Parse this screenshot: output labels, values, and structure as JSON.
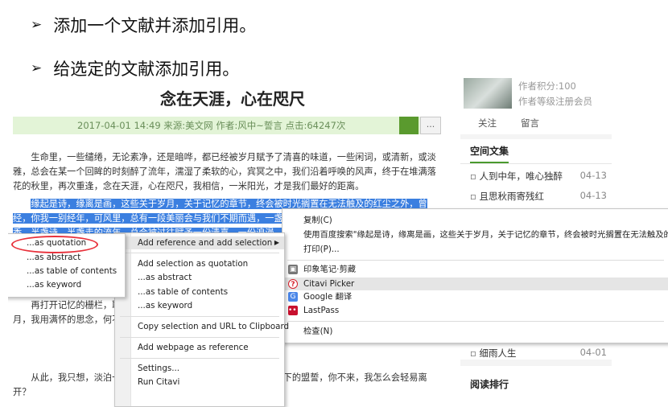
{
  "slide": {
    "bullet_marker": "➢",
    "bullet1": "添加一个文献并添加引用。",
    "bullet2": "给选定的文献添加引用。"
  },
  "article": {
    "title": "念在天涯，心在咫尺",
    "meta": "2017-04-01 14:49  来源:美文网  作者:风中~誓言  点击:64247次",
    "meta_button": "...",
    "para1": "生命里，一些缱绻，无论素净，还是暗哗，都已经被岁月赋予了清喜的味道，一些闲词，或清新，或淡雅，总会在某一个回眸的时刻醉了流年，濡湿了柔软的心，宾冥之中，我们沿着呼唤的风声，终于在堆满落花的秋里，再次重逢，念在天涯，心在咫尺，我相信，一米阳光，才是我们最好的距离。",
    "para2_sel": "缘起是诗，缘离是画，这些关于岁月，关于记忆的章节，终会被时光搁置在无法触及的红尘之外，曾经，你我一别经年，可风里，总有一段美丽会与我们不期而遇，一盏琉璃，半盏流年，半盏清茶，半盏茶香，半盏诗，半盏走的流年，总会被过往赋予一份清喜，一份浪漫。",
    "para3": "再打开记忆的栅栏，取出那一缕清风，养着忧伤，捻一缕清芬，看风声散尽，空锁清秋，无眼，这个十月，我用满怀的思念，何不见了原来这世间的繁华，让所有的一切都如逝水匆匆，去了遥远的天涯？",
    "para4": "从此，我只想，淡泊一颗心，在这个岁月的路口，静静等待你许下的盟誓，你不来，我怎么会轻易离开？"
  },
  "sidebar": {
    "points": "作者积分:100",
    "level": "作者等级注册会员",
    "follow": "关注",
    "message": "留言",
    "collection_title": "空间文集",
    "items": [
      {
        "title": "人到中年，唯心独醉",
        "date": "04-13"
      },
      {
        "title": "且思秋雨寄残红",
        "date": "04-13"
      },
      {
        "title": "细雨人生",
        "date": "04-01"
      }
    ],
    "rank_title": "阅读排行"
  },
  "sub_menu": {
    "items": [
      "...as quotation",
      "...as abstract",
      "...as table of contents",
      "...as keyword"
    ]
  },
  "citavi_menu": {
    "header": "Add reference and add selection",
    "submark": "▶",
    "items": [
      "Add selection as quotation",
      "...as abstract",
      "...as table of contents",
      "...as keyword",
      "Copy selection and URL to Clipboard",
      "Add webpage as reference",
      "Settings...",
      "Run Citavi"
    ]
  },
  "context_menu": {
    "copy": "复制(C)",
    "baidu": "使用百度搜索\"缘起是诗，缘离是画，这些关于岁月，关于记忆的章节，终会被时光搁置在无法触及的红尘之外，曾",
    "print": "打印(P)...",
    "evernote": "印象笔记·剪藏",
    "citavi": "Citavi Picker",
    "google": "Google 翻译",
    "lastpass": "LastPass",
    "inspect": "检查(N)"
  },
  "colors": {
    "selection": "#3b7fe0",
    "accent_green": "#4a9a2e",
    "annotation_red": "#e8303a"
  }
}
